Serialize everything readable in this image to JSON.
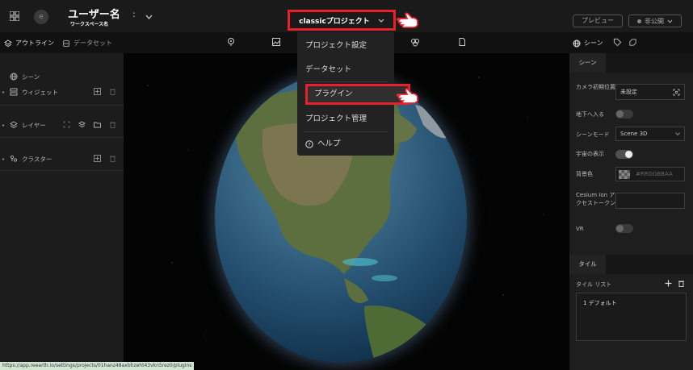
{
  "header": {
    "avatar_letter": "e",
    "user_name": "ユーザー名",
    "workspace_name": "ワークスペース名",
    "colon": ":",
    "project_label": "classicプロジェクト",
    "preview_label": "プレビュー",
    "publish_label": "非公開"
  },
  "subbar": {
    "outline_tab": "アウトライン",
    "dataset_tab": "データセット",
    "scene_tab": "シーン"
  },
  "left_panel": {
    "scene": "シーン",
    "widget": "ウィジェット",
    "layer": "レイヤー",
    "cluster": "クラスター"
  },
  "dropdown": {
    "items": [
      "プロジェクト設定",
      "データセット",
      "プラグイン",
      "プロジェクト管理",
      "ヘルプ"
    ]
  },
  "right_panel": {
    "section_scene": "シーン",
    "camera_label": "カメラ初期位置",
    "camera_value": "未設定",
    "underground_label": "地下へ入る",
    "scene_mode_label": "シーンモード",
    "scene_mode_value": "Scene 3D",
    "space_label": "宇宙の表示",
    "bg_color_label": "背景色",
    "bg_color_value": "#RRGGBBAA",
    "cesium_label": "Cesium Ion アクセストークン",
    "vr_label": "VR",
    "section_tile": "タイル",
    "tile_list_label": "タイル リスト",
    "tile_item": "1  デフォルト"
  },
  "status_url": "https://app.reearth.io/settings/projects/01hanz48axbhzeht43vkn5rez0/plugins",
  "colors": {
    "highlight": "#e8202a",
    "bg": "#1a1a1a"
  }
}
